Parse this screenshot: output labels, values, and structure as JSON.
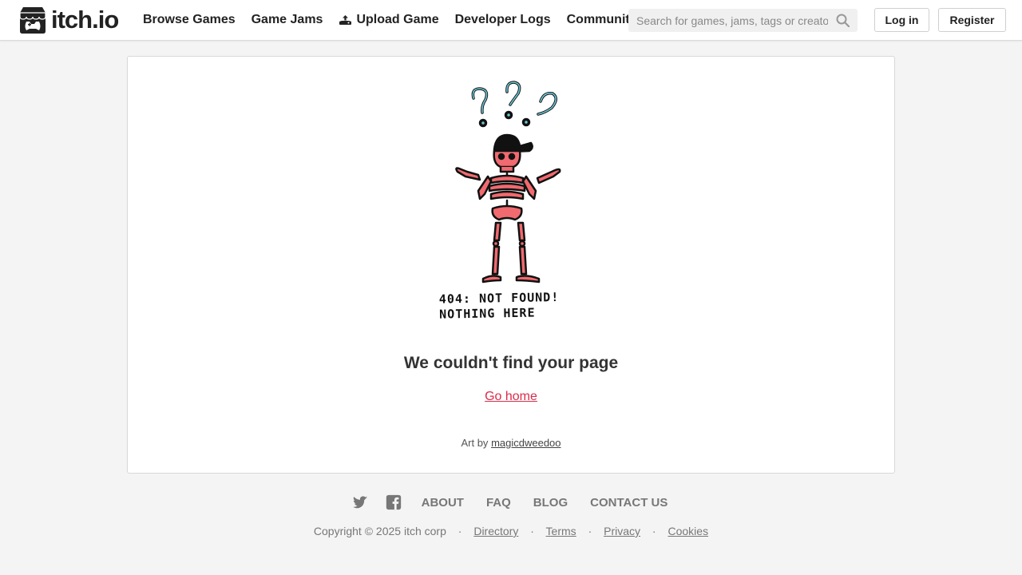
{
  "brand": {
    "name": "itch.io"
  },
  "nav": {
    "items": [
      {
        "label": "Browse Games"
      },
      {
        "label": "Game Jams"
      },
      {
        "label": "Upload Game",
        "icon": "upload-icon"
      },
      {
        "label": "Developer Logs"
      },
      {
        "label": "Community"
      }
    ]
  },
  "search": {
    "placeholder": "Search for games, jams, tags or creators",
    "value": ""
  },
  "auth": {
    "login_label": "Log in",
    "register_label": "Register"
  },
  "error": {
    "art_caption_line1": "404: NOT FOUND!",
    "art_caption_line2": "NOTHING HERE",
    "title": "We couldn't find your page",
    "home_link": "Go home",
    "credit_prefix": "Art by",
    "credit_author": "magicdweedoo"
  },
  "footer": {
    "social": [
      "twitter-icon",
      "facebook-icon"
    ],
    "links": [
      "ABOUT",
      "FAQ",
      "BLOG",
      "CONTACT US"
    ],
    "copyright": "Copyright © 2025 itch corp",
    "bottom_links": [
      "Directory",
      "Terms",
      "Privacy",
      "Cookies"
    ]
  },
  "colors": {
    "accent": "#da2c49",
    "skeleton": "#f06a6f",
    "question_marks": "#6cc7d8",
    "background": "#f4f4f4"
  }
}
